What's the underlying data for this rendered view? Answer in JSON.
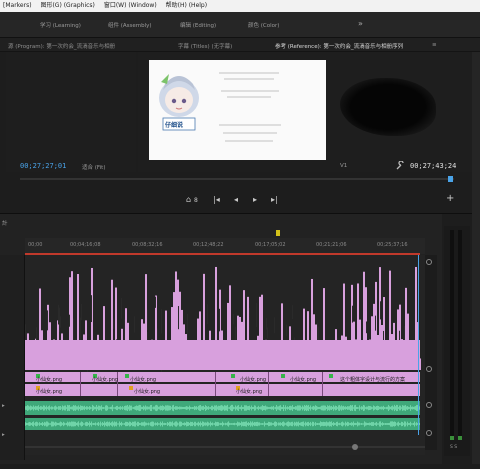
{
  "menubar": {
    "items": [
      "[Markers)",
      "图形(G) (Graphics)",
      "窗口(W) (Window)",
      "帮助(H) (Help)"
    ]
  },
  "workspaces": {
    "items": [
      "学习 (Learning)",
      "组件 (Assembly)",
      "编辑 (Editing)",
      "颜色 (Color)"
    ],
    "more": "»"
  },
  "panel_tabs": {
    "program": "源 (Program): 第一次约会_流淌音乐与相册",
    "captions": "字幕 (Titles) (无字幕)",
    "reference": "参考 (Reference): 第一次约会_流淌音乐与相册序列",
    "menu_icon": "≡"
  },
  "monitor": {
    "timecode_left": "00;27;27;01",
    "fit_label": "适合 (Fit)",
    "track_select": "V1",
    "timecode_right": "00;27;43;24",
    "wrench_icon": "wrench-icon",
    "preview_logo_text": "仔细说"
  },
  "transport": {
    "marker_count": "8",
    "buttons": [
      "step-back",
      "prev-frame",
      "play",
      "next-frame",
      "step-forward"
    ],
    "add_label": "+"
  },
  "timeline": {
    "tab_label": "計",
    "ruler_ticks": [
      "00;00",
      "00;04;16;08",
      "00;08;32;16",
      "00;12;48;22",
      "00;17;05;02",
      "00;21;21;06",
      "00;25;37;16"
    ],
    "clip_labels_v": [
      "小仙女.png",
      "小仙女.png",
      "小仙女.png",
      "小仙女.png",
      "小仙女.png",
      "这个粗体字设计与流行的方案"
    ],
    "clip_labels_a": [
      "小仙女.png",
      "小仙女.png",
      "小仙女.png"
    ]
  },
  "meters": {
    "bottom_label": "S S"
  },
  "colors": {
    "accent_blue": "#4aa3e8",
    "clip_pink": "#d8a0dd",
    "clip_green": "#3fa87a",
    "playhead_red": "#c0392b"
  }
}
